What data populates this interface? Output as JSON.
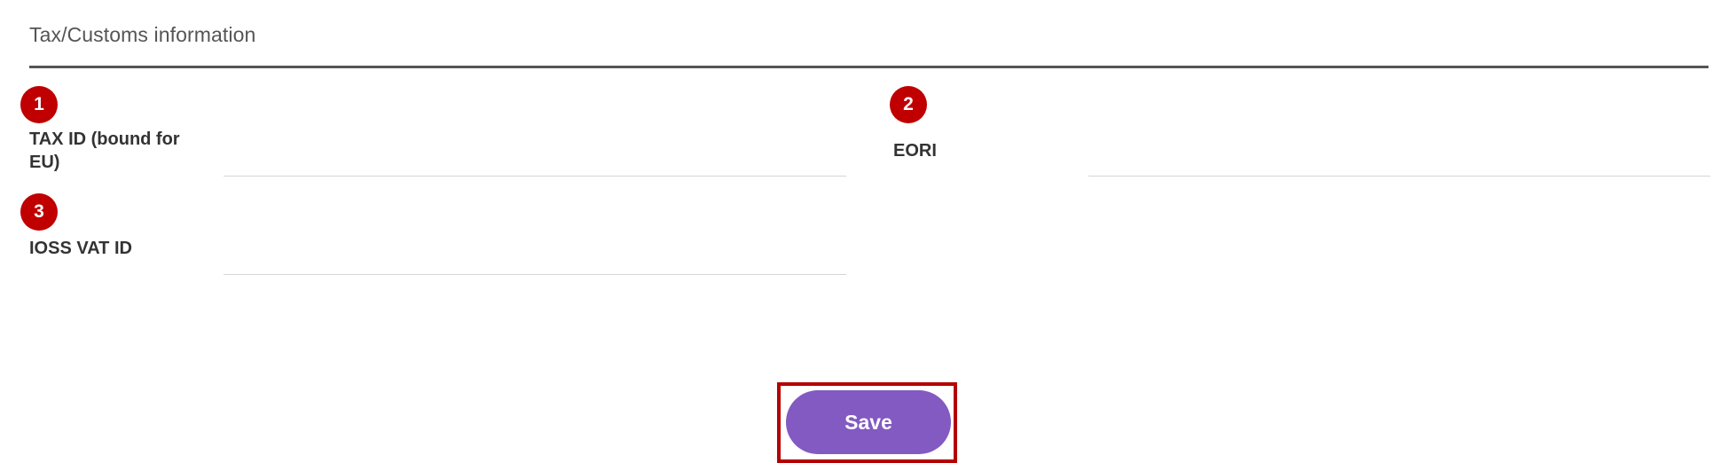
{
  "section": {
    "title": "Tax/Customs information"
  },
  "badges": [
    "1",
    "2",
    "3"
  ],
  "fields": {
    "tax_id": {
      "label": "TAX ID (bound for EU)",
      "value": ""
    },
    "eori": {
      "label": "EORI",
      "value": ""
    },
    "ioss_vat_id": {
      "label": "IOSS VAT ID",
      "value": ""
    }
  },
  "actions": {
    "save_label": "Save"
  },
  "colors": {
    "badge": "#c00000",
    "save_button": "#8359c2",
    "highlight_border": "#b40000",
    "divider": "#555555"
  }
}
